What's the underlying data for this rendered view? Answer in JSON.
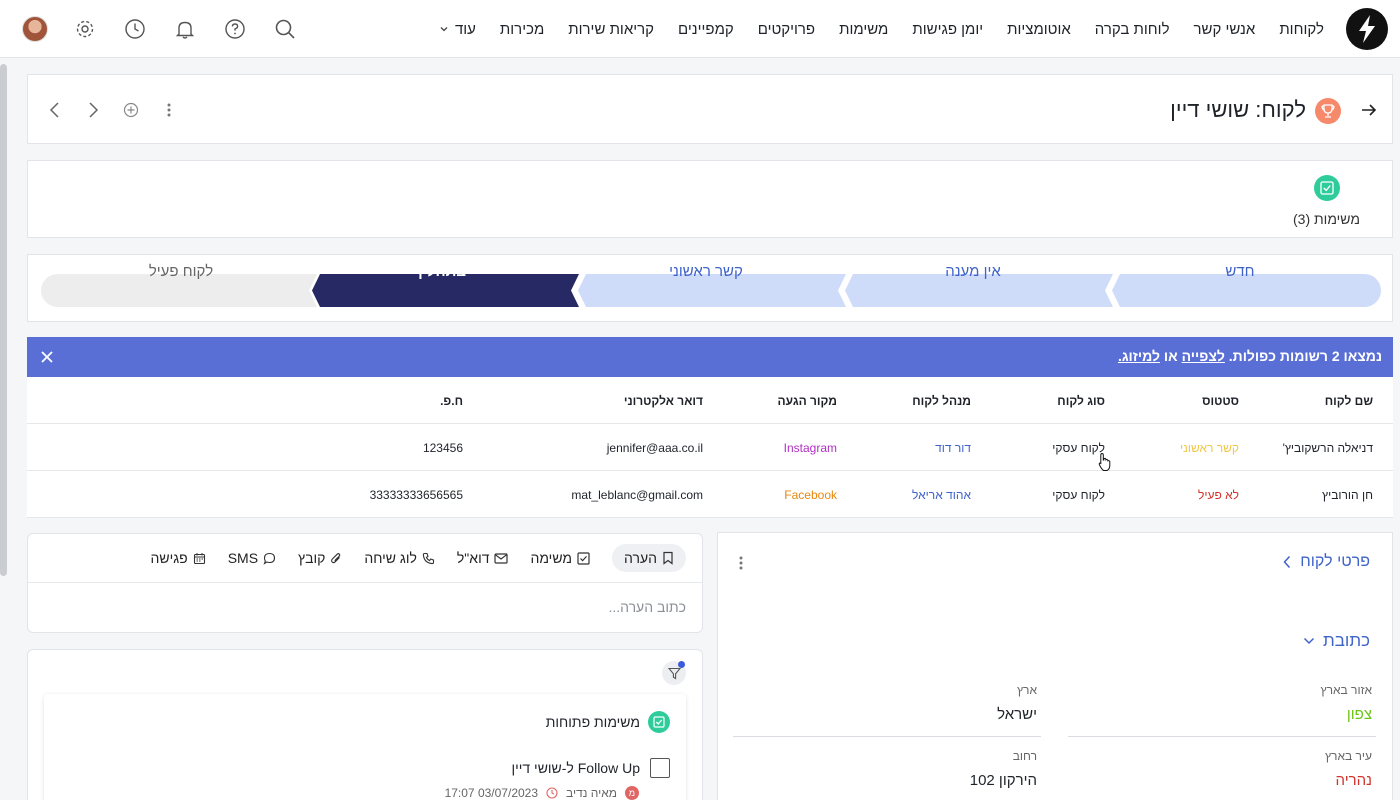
{
  "nav": {
    "items": [
      "לקוחות",
      "אנשי קשר",
      "לוחות בקרה",
      "אוטומציות",
      "יומן פגישות",
      "משימות",
      "פרויקטים",
      "קמפיינים",
      "קריאות שירות",
      "מכירות"
    ],
    "more_label": "עוד",
    "icons": [
      "search-icon",
      "help-icon",
      "bell-icon",
      "history-icon",
      "settings-icon",
      "avatar"
    ]
  },
  "header": {
    "title": "לקוח: שושי דיין",
    "icons": [
      "back-arrow-icon",
      "trophy-icon",
      "kebab-icon",
      "add-circle-icon",
      "chevron-right-icon",
      "chevron-left-icon"
    ]
  },
  "tasks_summary": {
    "label": "משימות (3)"
  },
  "pipeline": {
    "stages": [
      {
        "label": "חדש",
        "state": "done"
      },
      {
        "label": "אין מענה",
        "state": "done"
      },
      {
        "label": "קשר ראשוני",
        "state": "done"
      },
      {
        "label": "בתהליך",
        "state": "current"
      },
      {
        "label": "לקוח פעיל",
        "state": "future"
      }
    ],
    "colors": {
      "done_bg": "#cfdcf9",
      "done_text": "#3e63c9",
      "current_bg": "#262963",
      "current_text": "#ffffff",
      "future_bg": "#ededee",
      "future_text": "#666666"
    }
  },
  "duplicates": {
    "prefix": "נמצאו 2 רשומות כפולות.",
    "view_link": "לצפייה",
    "or": "או",
    "merge_link": "למיזוג.",
    "columns": [
      "שם לקוח",
      "סטטוס",
      "סוג לקוח",
      "מנהל לקוח",
      "מקור הגעה",
      "דואר אלקטרוני",
      "ח.פ."
    ],
    "rows": [
      {
        "name": "דניאלה הרשקוביץ'",
        "status": "קשר ראשוני",
        "status_color": "#f2c744",
        "type": "לקוח עסקי",
        "manager": "דור דוד",
        "source": "Instagram",
        "source_color": "#b32fc6",
        "email": "jennifer@aaa.co.il",
        "hp": "123456"
      },
      {
        "name": "חן הורוביץ",
        "status": "לא פעיל",
        "status_color": "#d0342c",
        "type": "לקוח עסקי",
        "manager": "אהוד אריאל",
        "source": "Facebook",
        "source_color": "#e8880c",
        "email": "mat_leblanc@gmail.com",
        "hp": "33333333656565"
      }
    ]
  },
  "details": {
    "title": "פרטי לקוח",
    "address_title": "כתובת",
    "fields": [
      {
        "label": "אזור בארץ",
        "value": "צפון",
        "color": "#6cc417"
      },
      {
        "label": "ארץ",
        "value": "ישראל",
        "color": "#1f2329"
      },
      {
        "label": "עיר בארץ",
        "value": "נהריה",
        "color": "#d0342c"
      },
      {
        "label": "רחוב",
        "value": "הירקון 102",
        "color": "#1f2329"
      }
    ]
  },
  "composer": {
    "tabs": [
      {
        "label": "הערה",
        "icon": "bookmark-icon"
      },
      {
        "label": "משימה",
        "icon": "checkbox-icon"
      },
      {
        "label": "דוא\"ל",
        "icon": "mail-icon"
      },
      {
        "label": "לוג שיחה",
        "icon": "phone-icon"
      },
      {
        "label": "קובץ",
        "icon": "paperclip-icon"
      },
      {
        "label": "SMS",
        "icon": "chat-icon"
      },
      {
        "label": "פגישה",
        "icon": "calendar-icon"
      }
    ],
    "placeholder": "כתוב הערה..."
  },
  "activity": {
    "open_tasks_title": "משימות פתוחות",
    "task": {
      "title": "Follow Up ל-שושי דיין",
      "assignee_initial": "מ",
      "assignee": "מאיה נדיב",
      "datetime": "03/07/2023 17:07"
    }
  }
}
